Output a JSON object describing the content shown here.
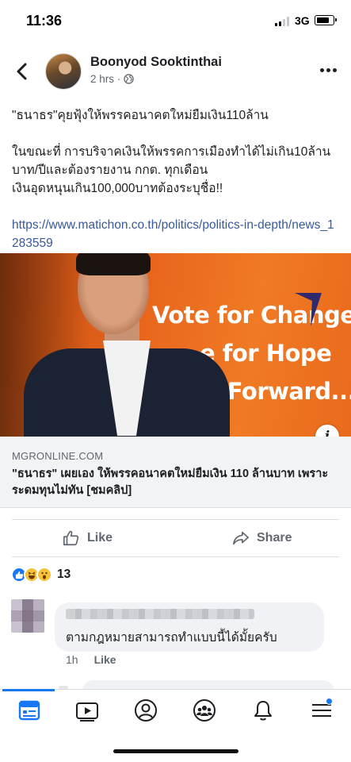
{
  "status_bar": {
    "time": "11:36",
    "network": "3G",
    "signal_bars_active": 2,
    "signal_bars_total": 4,
    "battery_level": 0.72
  },
  "post": {
    "author": "Boonyod Sooktinthai",
    "time_ago": "2 hrs · ",
    "paragraphs": [
      "\"ธนาธร\"คุยฟุ้งให้พรรคอนาคตใหม่ยืมเงิน110ล้าน",
      "ในขณะที่ การบริจาคเงินให้พรรคการเมืองทำได้ไม่เกิน10ล้านบาท/ปีและต้องรายงาน กกต. ทุกเดือน\nเงินอุดหนุนเกิน100,000บาทต้องระบุชื่อ!!"
    ],
    "link": "https://www.matichon.co.th/politics/politics-in-depth/news_1283559",
    "preview": {
      "banner_lines": [
        "Vote for Change",
        "e for Hope",
        "e Forward..."
      ],
      "info_icon_label": "i",
      "domain": "MGRONLINE.COM",
      "title": "\"ธนาธร\" เผยเอง ให้พรรคอนาคตใหม่ยืมเงิน 110 ล้านบาท เพราะระดมทุนไม่ทัน [ชมคลิป]"
    },
    "actions": {
      "like": "Like",
      "share": "Share"
    },
    "reactions": {
      "types": [
        "like",
        "haha",
        "wow"
      ],
      "count": "13"
    },
    "comment": {
      "text": "ตามกฎหมายสามารถทำแบบนี้ได้มั้ยครับ",
      "time": "1h",
      "like": "Like"
    }
  },
  "tab_bar": {
    "tabs": [
      "home",
      "watch",
      "profile",
      "groups",
      "notifications",
      "menu"
    ],
    "active": "home",
    "accent_color": "#1877f2"
  },
  "colors": {
    "link": "#385898",
    "secondary_text": "#606770",
    "preview_bg": "#f2f3f5",
    "banner_orange": "#e8661c"
  }
}
